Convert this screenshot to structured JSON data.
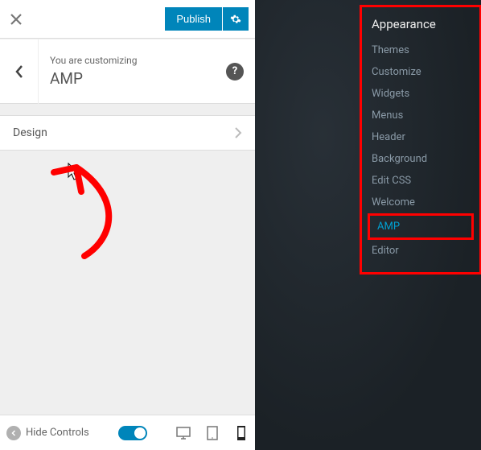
{
  "topbar": {
    "publish_label": "Publish"
  },
  "header": {
    "customizing_label": "You are customizing",
    "target": "AMP"
  },
  "sections": [
    {
      "label": "Design"
    }
  ],
  "footer": {
    "hide_controls": "Hide Controls"
  },
  "sidebar": {
    "header": "Appearance",
    "items": [
      {
        "label": "Themes",
        "active": false
      },
      {
        "label": "Customize",
        "active": false
      },
      {
        "label": "Widgets",
        "active": false
      },
      {
        "label": "Menus",
        "active": false
      },
      {
        "label": "Header",
        "active": false
      },
      {
        "label": "Background",
        "active": false
      },
      {
        "label": "Edit CSS",
        "active": false
      },
      {
        "label": "Welcome",
        "active": false
      },
      {
        "label": "AMP",
        "active": true
      },
      {
        "label": "Editor",
        "active": false
      }
    ]
  }
}
